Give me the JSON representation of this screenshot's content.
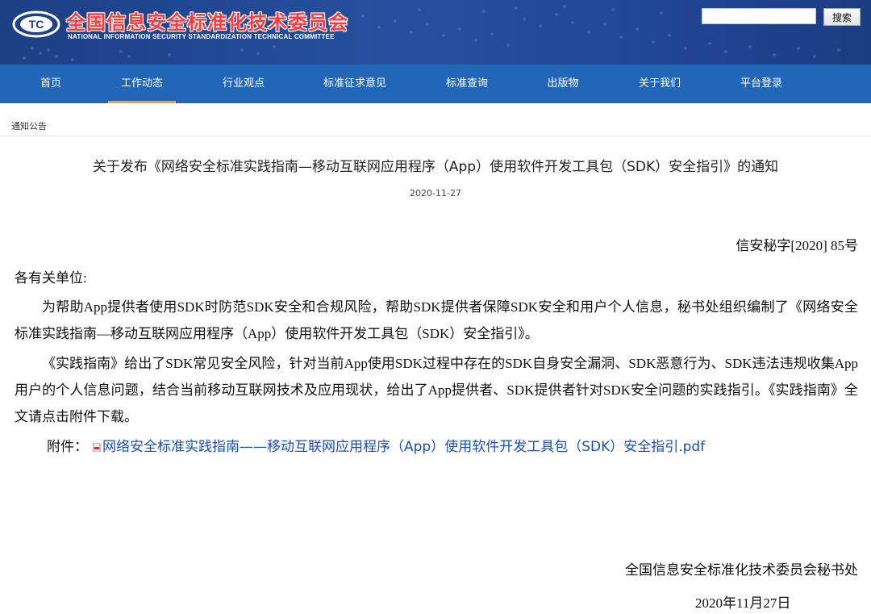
{
  "header": {
    "site_title": "全国信息安全标准化技术委员会",
    "site_subtitle": "NATIONAL INFORMATION SECURITY STANDARDIZATION TECHNICAL COMMITTEE",
    "logo_text": "TC",
    "search_value": "",
    "search_button": "搜索"
  },
  "nav": {
    "items": [
      {
        "label": "首页"
      },
      {
        "label": "工作动态",
        "active": true
      },
      {
        "label": "行业观点"
      },
      {
        "label": "标准征求意见"
      },
      {
        "label": "标准查询"
      },
      {
        "label": "出版物"
      },
      {
        "label": "关于我们"
      },
      {
        "label": "平台登录"
      }
    ]
  },
  "breadcrumb": "通知公告",
  "article": {
    "title": "关于发布《网络安全标准实践指南—移动互联网应用程序（App）使用软件开发工具包（SDK）安全指引》的通知",
    "date": "2020-11-27",
    "doc_number": "信安秘字[2020] 85号",
    "salutation": "各有关单位:",
    "paragraphs": [
      "为帮助App提供者使用SDK时防范SDK安全和合规风险，帮助SDK提供者保障SDK安全和用户个人信息，秘书处组织编制了《网络安全标准实践指南—移动互联网应用程序（App）使用软件开发工具包（SDK）安全指引》。",
      "《实践指南》给出了SDK常见安全风险，针对当前App使用SDK过程中存在的SDK自身安全漏洞、SDK恶意行为、SDK违法违规收集App用户的个人信息问题，结合当前移动互联网技术及应用现状，给出了App提供者、SDK提供者针对SDK安全问题的实践指引。《实践指南》全文请点击附件下载。"
    ],
    "attachment_label": "附件：",
    "attachment_link": "网络安全标准实践指南——移动互联网应用程序（App）使用软件开发工具包（SDK）安全指引.pdf",
    "signature": "全国信息安全标准化技术委员会秘书处",
    "sign_date": "2020年11月27日"
  },
  "colors": {
    "header_bg": "#21489a",
    "nav_bg": "#2266b8",
    "nav_active_underline": "#f6a21b",
    "title_red": "#ff3b3b",
    "link_blue": "#1a4fb5"
  },
  "icons": {
    "logo": "tc-logo-icon",
    "attachment": "pdf-file-icon"
  }
}
